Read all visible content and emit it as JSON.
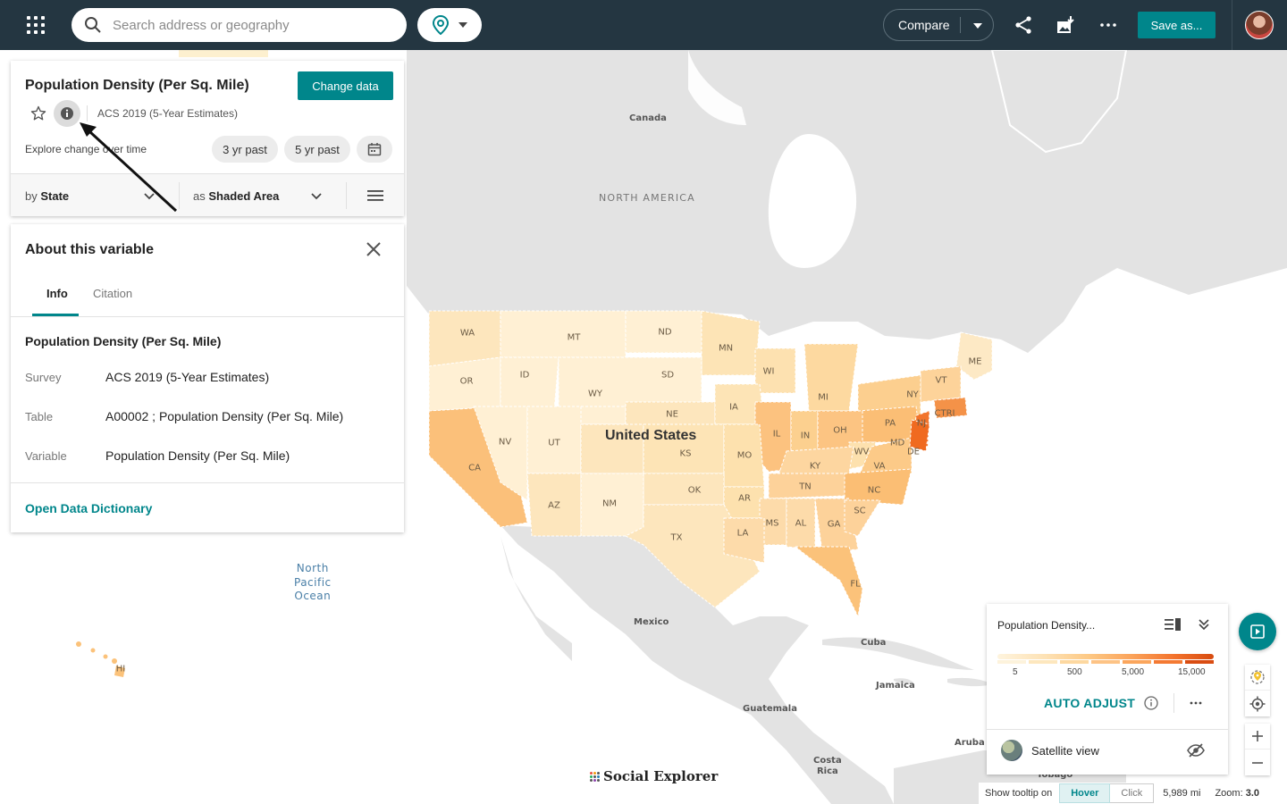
{
  "topbar": {
    "search_placeholder": "Search address or geography",
    "compare_label": "Compare",
    "save_label": "Save as..."
  },
  "data_panel": {
    "title": "Population Density (Per Sq. Mile)",
    "change_data_label": "Change data",
    "survey": "ACS 2019 (5-Year Estimates)",
    "explore_label": "Explore change over time",
    "pills": [
      "3 yr past",
      "5 yr past"
    ],
    "by_prefix": "by",
    "by_value": "State",
    "as_prefix": "as",
    "as_value": "Shaded Area"
  },
  "about_panel": {
    "title": "About this variable",
    "tabs": [
      "Info",
      "Citation"
    ],
    "active_tab": "Info",
    "variable_title": "Population Density (Per Sq. Mile)",
    "rows": [
      {
        "label": "Survey",
        "value": "ACS 2019 (5-Year Estimates)"
      },
      {
        "label": "Table",
        "value": "A00002 ; Population Density (Per Sq. Mile)"
      },
      {
        "label": "Variable",
        "value": "Population Density (Per Sq. Mile)"
      }
    ],
    "link_label": "Open Data Dictionary"
  },
  "map": {
    "labels": {
      "canada": "Canada",
      "north_america": "NORTH AMERICA",
      "united_states": "United States",
      "mexico": "Mexico",
      "cuba": "Cuba",
      "jamaica": "Jamaica",
      "guatemala": "Guatemala",
      "costa_rica": "Costa\nRica",
      "aruba": "Aruba",
      "tobago": "Tobago",
      "ocean": "North\nPacific\nOcean"
    },
    "states": [
      "WA",
      "MT",
      "ND",
      "MN",
      "ME",
      "OR",
      "ID",
      "SD",
      "WI",
      "VT",
      "NY",
      "MI",
      "WY",
      "CTRI",
      "NE",
      "IA",
      "PA",
      "NJ",
      "NV",
      "UT",
      "KS",
      "IL",
      "IN",
      "OH",
      "MD",
      "DE",
      "CA",
      "MO",
      "WV",
      "KY",
      "VA",
      "OK",
      "AR",
      "TN",
      "NC",
      "AZ",
      "NM",
      "MS",
      "AL",
      "GA",
      "SC",
      "TX",
      "LA",
      "FL",
      "HI"
    ],
    "brand": "Social Explorer",
    "colors": {
      "land": "#e3e3e3",
      "water": "#ffffff",
      "accent": "#00868b"
    }
  },
  "legend": {
    "title": "Population Density...",
    "ticks": [
      "5",
      "500",
      "5,000",
      "15,000"
    ],
    "auto_adjust_label": "AUTO ADJUST",
    "satellite_label": "Satellite view"
  },
  "status": {
    "tooltip_label": "Show tooltip on",
    "hover_label": "Hover",
    "click_label": "Click",
    "scale": "5,989 mi",
    "zoom_label": "Zoom:",
    "zoom_value": "3.0"
  }
}
